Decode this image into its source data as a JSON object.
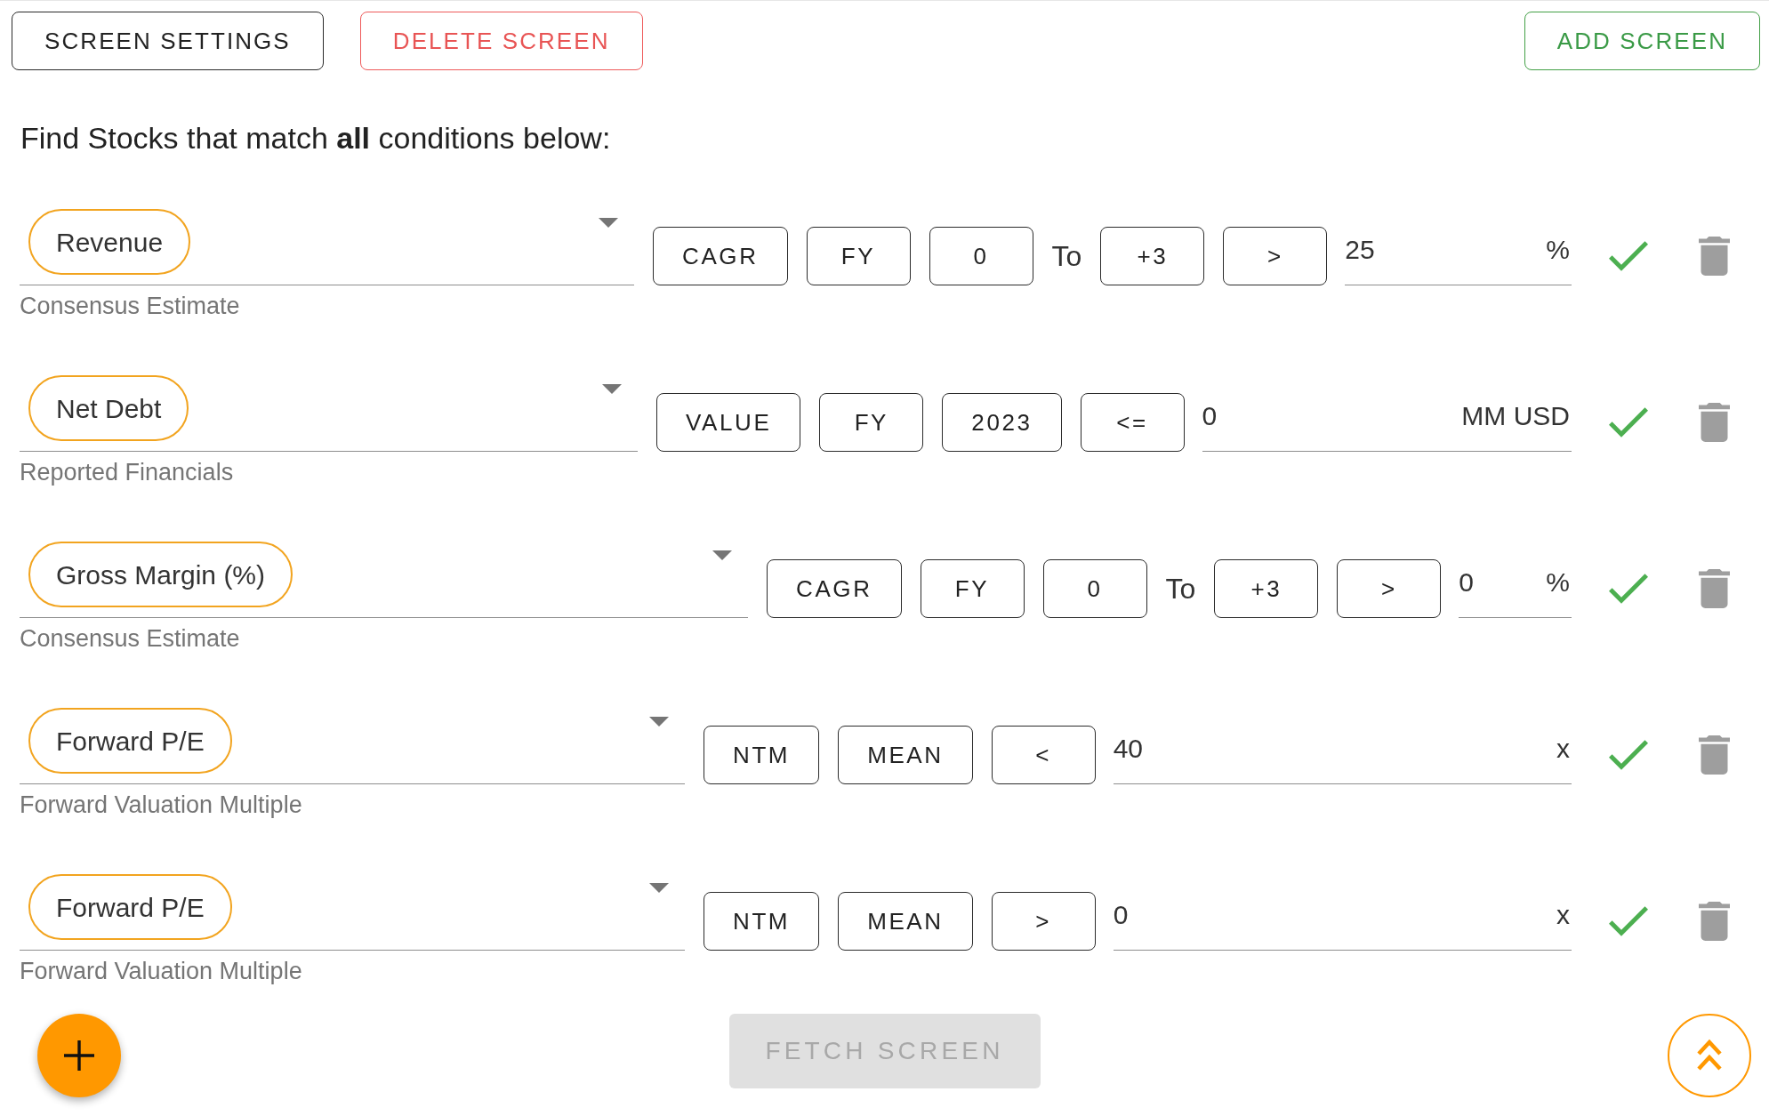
{
  "toolbar": {
    "left_buttons": [
      {
        "label": "SCREEN SETTINGS",
        "kind": "settings"
      },
      {
        "label": "DELETE SCREEN",
        "kind": "delete"
      }
    ],
    "right_buttons": [
      {
        "label": "ADD SCREEN",
        "kind": "add"
      }
    ]
  },
  "heading": "Find Stocks that match **all** conditions below:",
  "conditions": [
    {
      "metric": "Revenue",
      "source": "Consensus Estimate",
      "options": [
        {
          "kind": "button",
          "label": "CAGR"
        },
        {
          "kind": "button",
          "label": "FY"
        },
        {
          "kind": "button",
          "label": "0"
        },
        {
          "kind": "text",
          "label": "To"
        },
        {
          "kind": "button",
          "label": "+3"
        },
        {
          "kind": "button",
          "label": ">"
        }
      ],
      "value": "25",
      "unit": "%",
      "valid": true
    },
    {
      "metric": "Net Debt",
      "source": "Reported Financials",
      "options": [
        {
          "kind": "button",
          "label": "VALUE"
        },
        {
          "kind": "button",
          "label": "FY"
        },
        {
          "kind": "button",
          "label": "2023"
        },
        {
          "kind": "button",
          "label": "<="
        }
      ],
      "value": "0",
      "unit": "MM USD",
      "valid": true
    },
    {
      "metric": "Gross Margin (%)",
      "source": "Consensus Estimate",
      "options": [
        {
          "kind": "button",
          "label": "CAGR"
        },
        {
          "kind": "button",
          "label": "FY"
        },
        {
          "kind": "button",
          "label": "0"
        },
        {
          "kind": "text",
          "label": "To"
        },
        {
          "kind": "button",
          "label": "+3"
        },
        {
          "kind": "button",
          "label": ">"
        }
      ],
      "value": "0",
      "unit": "%",
      "valid": true
    },
    {
      "metric": "Forward P/E",
      "source": "Forward Valuation Multiple",
      "options": [
        {
          "kind": "button",
          "label": "NTM"
        },
        {
          "kind": "button",
          "label": "MEAN"
        },
        {
          "kind": "button",
          "label": "<"
        }
      ],
      "value": "40",
      "unit": "x",
      "valid": true
    },
    {
      "metric": "Forward P/E",
      "source": "Forward Valuation Multiple",
      "options": [
        {
          "kind": "button",
          "label": "NTM"
        },
        {
          "kind": "button",
          "label": "MEAN"
        },
        {
          "kind": "button",
          "label": ">"
        }
      ],
      "value": "0",
      "unit": "x",
      "valid": true
    }
  ],
  "footer": {
    "fetch_button": {
      "label": "FETCH SCREEN",
      "disabled": true
    }
  }
}
